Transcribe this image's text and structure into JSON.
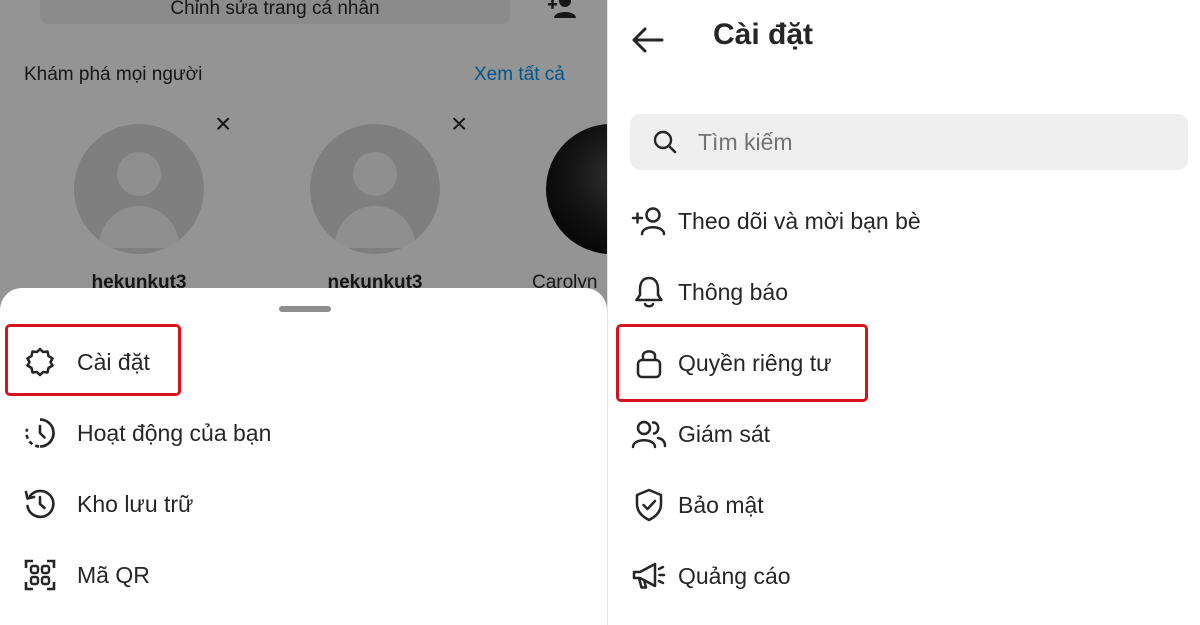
{
  "profile": {
    "edit_profile_label": "Chỉnh sửa trang cá nhân",
    "discover_title": "Khám phá mọi người",
    "see_all_label": "Xem tất cả",
    "suggestions": [
      {
        "username": "hekunkut3"
      },
      {
        "username": "nekunkut3"
      },
      {
        "username": "Carolyn"
      }
    ]
  },
  "menu": {
    "items": [
      {
        "label": "Cài đặt",
        "icon": "settings-gear-icon"
      },
      {
        "label": "Hoạt động của bạn",
        "icon": "activity-clock-icon"
      },
      {
        "label": "Kho lưu trữ",
        "icon": "archive-history-icon"
      },
      {
        "label": "Mã QR",
        "icon": "qr-code-icon"
      }
    ]
  },
  "settings": {
    "title": "Cài đặt",
    "search_placeholder": "Tìm kiếm",
    "items": [
      {
        "label": "Theo dõi và mời bạn bè",
        "icon": "add-person-icon"
      },
      {
        "label": "Thông báo",
        "icon": "bell-icon"
      },
      {
        "label": "Quyền riêng tư",
        "icon": "lock-icon"
      },
      {
        "label": "Giám sát",
        "icon": "supervision-people-icon"
      },
      {
        "label": "Bảo mật",
        "icon": "shield-check-icon"
      },
      {
        "label": "Quảng cáo",
        "icon": "megaphone-icon"
      }
    ]
  },
  "colors": {
    "highlight": "#d6121e",
    "link_blue": "#0095f6",
    "text": "#262626",
    "search_bg": "#efefef"
  }
}
